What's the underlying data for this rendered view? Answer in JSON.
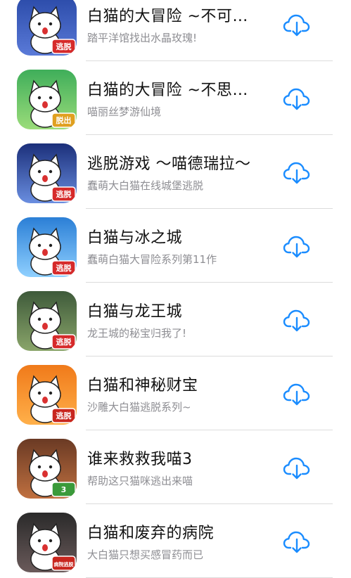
{
  "colors": {
    "accent": "#1a8cff",
    "title": "#111111",
    "subtitle": "#8e8e93",
    "divider": "#dcdcdc"
  },
  "download_icon": "cloud-download-icon",
  "apps": [
    {
      "title": "白猫的大冒险 ~不可…",
      "subtitle": "踏平洋馆找出水晶玫瑰!",
      "icon_badge": "逃脱",
      "icon_bg": [
        "#2a4aa8",
        "#5a7ad8"
      ],
      "badge_color": "#d62a2a"
    },
    {
      "title": "白猫的大冒险 ~不思…",
      "subtitle": "喵丽丝梦游仙境",
      "icon_badge": "脱出",
      "icon_bg": [
        "#3fae5a",
        "#9bdc7a"
      ],
      "badge_color": "#e0a020"
    },
    {
      "title": "逃脱游戏 ～喵德瑞拉～",
      "subtitle": "蠢萌大白猫在线城堡逃脱",
      "icon_badge": "逃脱",
      "icon_bg": [
        "#1b2f7a",
        "#6a8ee0"
      ],
      "badge_color": "#d62a2a"
    },
    {
      "title": "白猫与冰之城",
      "subtitle": "蠢萌白猫大冒险系列第11作",
      "icon_badge": "逃脱",
      "icon_bg": [
        "#2b7fd6",
        "#8fd0ff"
      ],
      "badge_color": "#d62a2a"
    },
    {
      "title": "白猫与龙王城",
      "subtitle": "龙王城的秘宝归我了!",
      "icon_badge": "逃脱",
      "icon_bg": [
        "#3e5a3a",
        "#8aa56a"
      ],
      "badge_color": "#d62a2a"
    },
    {
      "title": "白猫和神秘财宝",
      "subtitle": "沙雕大白猫逃脱系列~",
      "icon_badge": "逃脱",
      "icon_bg": [
        "#f07a1a",
        "#ffb04a"
      ],
      "badge_color": "#c8261e"
    },
    {
      "title": "谁来救救我喵3",
      "subtitle": "帮助这只猫咪逃出来喵",
      "icon_badge": "3",
      "icon_bg": [
        "#6a3a24",
        "#c07040"
      ],
      "badge_color": "#3a9a3a"
    },
    {
      "title": "白猫和废弃的病院",
      "subtitle": "大白猫只想买感冒药而已",
      "icon_badge": "病院逃脱",
      "icon_bg": [
        "#2a2a2a",
        "#6a5a5a"
      ],
      "badge_color": "#c8261e"
    }
  ]
}
